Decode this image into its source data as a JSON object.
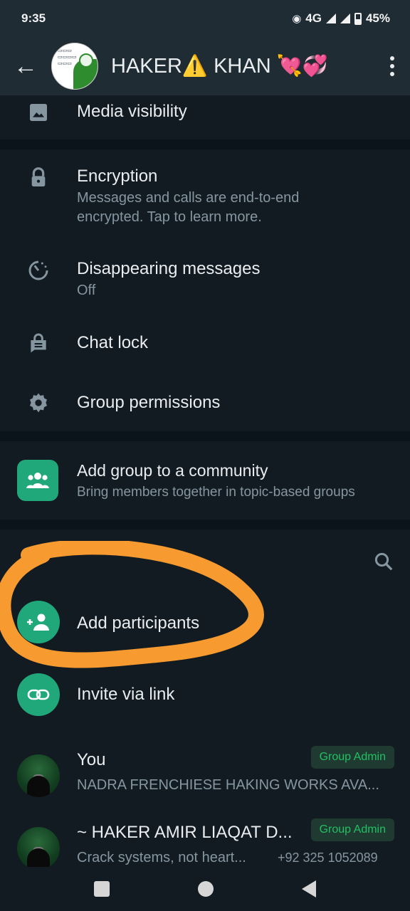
{
  "status_bar": {
    "time": "9:35",
    "network": "4G",
    "battery": "45%"
  },
  "header": {
    "title_part1": "HAKER",
    "warning_emoji": "⚠️",
    "title_part2": " KHAN ",
    "emoji_heart_arrow": "💘",
    "emoji_hearts": "💞"
  },
  "settings": {
    "media_visibility": "Media visibility",
    "encryption": "Encryption",
    "encryption_sub": "Messages and calls are end-to-end encrypted. Tap to learn more.",
    "disappearing": "Disappearing messages",
    "disappearing_sub": "Off",
    "chat_lock": "Chat lock",
    "group_permissions": "Group permissions"
  },
  "community": {
    "title": "Add group to a community",
    "subtitle": "Bring members together in topic-based groups"
  },
  "participants": {
    "add": "Add participants",
    "invite": "Invite via link",
    "members": [
      {
        "name": "You",
        "status": "NADRA FRENCHIESE HAKING WORKS AVA...",
        "badge": "Group Admin",
        "phone": ""
      },
      {
        "name": "~ HAKER AMIR LIAQAT D...",
        "status": "Crack systems, not heart...",
        "badge": "Group Admin",
        "phone": "+92 325 1052089"
      }
    ]
  },
  "colors": {
    "accent": "#21a87a",
    "background": "#121b22",
    "annotation": "#f79a30"
  }
}
